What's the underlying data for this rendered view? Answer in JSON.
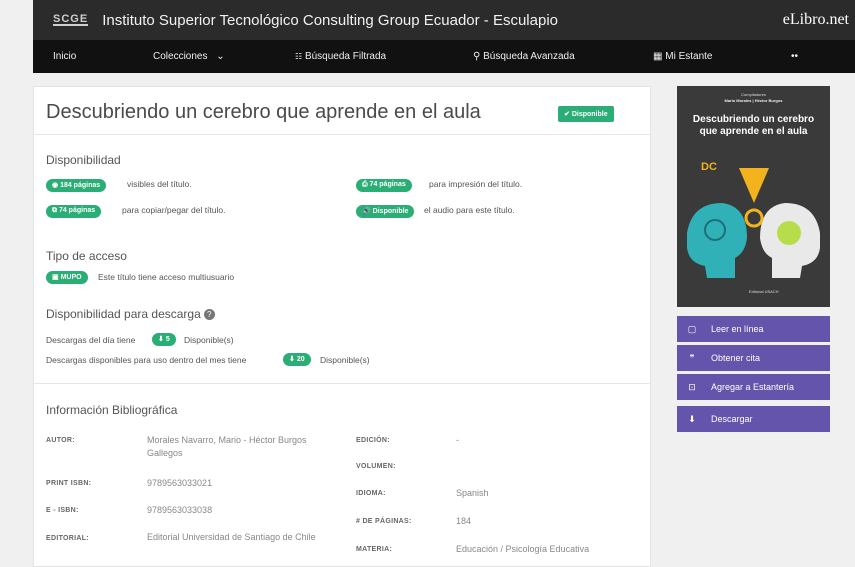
{
  "header": {
    "logo": "SCGE",
    "institution": "Instituto Superior Tecnológico Consulting Group Ecuador - Esculapio",
    "brand": "eLibro.net"
  },
  "nav": {
    "inicio": "Inicio",
    "colecciones": "Colecciones",
    "busqueda_filtrada": "Búsqueda Filtrada",
    "busqueda_avanzada": "Búsqueda Avanzada",
    "mi_estante": "Mi Estante",
    "more": "••"
  },
  "book": {
    "title": "Descubriendo un cerebro que aprende en el aula",
    "status": "Disponible"
  },
  "disponibilidad": {
    "heading": "Disponibilidad",
    "visible_pages": "184 páginas",
    "visible_text": "visibles del título.",
    "print_pages": "74 páginas",
    "print_text": "para impresión del título.",
    "copy_pages": "74 páginas",
    "copy_text": "para copiar/pegar del título.",
    "audio": "Disponible",
    "audio_text": "el audio para este título."
  },
  "acceso": {
    "heading": "Tipo de acceso",
    "type": "MUPO",
    "text": "Este título tiene acceso multiusuario"
  },
  "descarga": {
    "heading": "Disponibilidad para descarga",
    "help": "?",
    "day_text": "Descargas del día tiene",
    "day_count": "5",
    "day_suffix": "Disponible(s)",
    "month_text": "Descargas disponibles para uso dentro del mes tiene",
    "month_count": "20",
    "month_suffix": "Disponible(s)"
  },
  "biblio": {
    "heading": "Información Bibliográfica",
    "autor_label": "AUTOR:",
    "autor": "Morales Navarro, Mario - Héctor Burgos Gallegos",
    "print_isbn_label": "PRINT ISBN:",
    "print_isbn": "9789563033021",
    "eisbn_label": "E - ISBN:",
    "eisbn": "9789563033038",
    "editorial_label": "EDITORIAL:",
    "editorial": "Editorial Universidad de Santiago de Chile",
    "edicion_label": "EDICIÓN:",
    "edicion": "-",
    "volumen_label": "VOLUMEN:",
    "idioma_label": "IDIOMA:",
    "idioma": "Spanish",
    "paginas_label": "# DE PÁGINAS:",
    "paginas": "184",
    "materia_label": "MATERIA:",
    "materia": "Educación / Psicología Educativa"
  },
  "cover": {
    "compiladores_label": "Compiladores",
    "compiladores": "Mario Morales | Héctor Burgos",
    "title": "Descubriendo un cerebro que aprende en el aula",
    "publisher": "Editorial USACH"
  },
  "actions": {
    "leer": "Leer en línea",
    "cita": "Obtener cita",
    "estanteria": "Agregar a Estantería",
    "descargar": "Descargar"
  }
}
